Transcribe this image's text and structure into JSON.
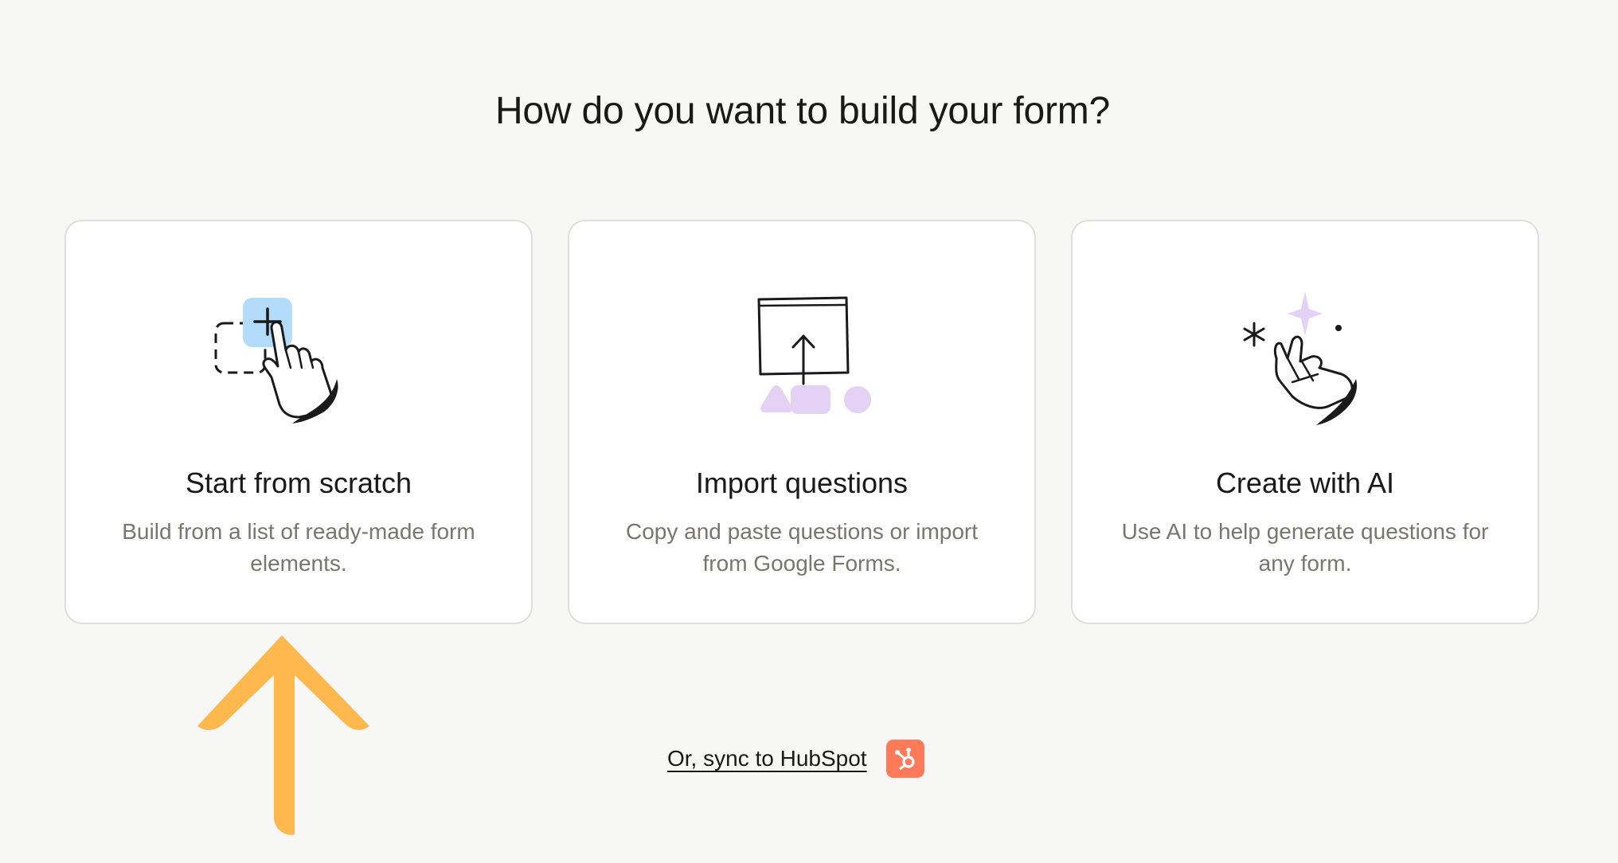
{
  "page": {
    "title": "How do you want to build your form?"
  },
  "cards": [
    {
      "title": "Start from scratch",
      "description": "Build from a list of ready-made form elements.",
      "icon": "add-element-hand-icon"
    },
    {
      "title": "Import questions",
      "description": "Copy and paste questions or import from Google Forms.",
      "icon": "import-upload-icon"
    },
    {
      "title": "Create with AI",
      "description": "Use AI to help generate questions for any form.",
      "icon": "ai-sparkle-hand-icon"
    }
  ],
  "sync": {
    "label": "Or, sync to HubSpot",
    "icon": "hubspot-icon"
  },
  "colors": {
    "background": "#f7f7f6",
    "card_border": "#dededc",
    "illustration_blue": "#b3dcfb",
    "illustration_lavender": "#e4d2f4",
    "hubspot_orange": "#ff7a59",
    "annotation_arrow": "#ffb84d",
    "description_text": "#77766f"
  }
}
